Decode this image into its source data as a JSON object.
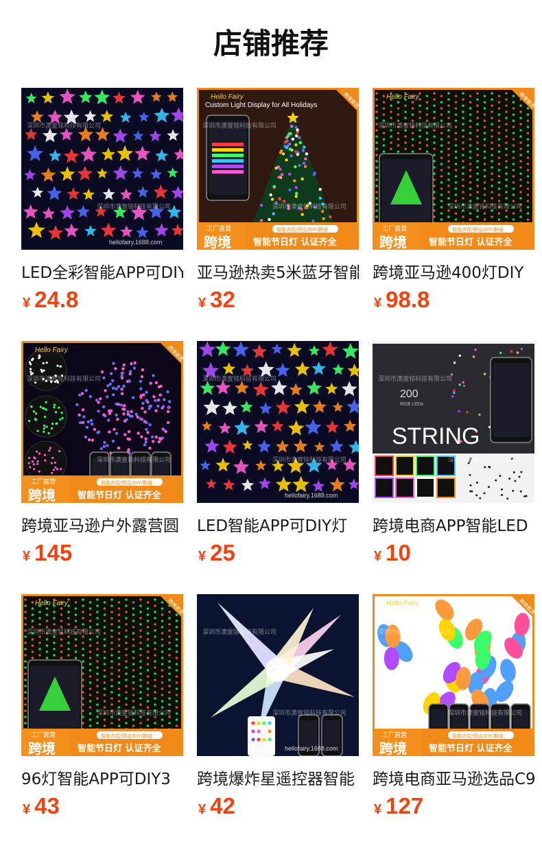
{
  "page": {
    "title": "店铺推荐"
  },
  "colors": {
    "price": "#f2420f",
    "banner_orange": "#f28a1a"
  },
  "products": [
    {
      "name": "LED全彩智能APP可DIY",
      "currency": "¥",
      "price": "24.8",
      "image_icon": "star-lights-icon",
      "brand_text": "",
      "watermark": "深圳市澳壹铭科技有限公司",
      "site": "hellofairy.1688.com",
      "banner": false,
      "caption": ""
    },
    {
      "name": "亚马逊热卖5米蓝牙智能",
      "currency": "¥",
      "price": "32",
      "image_icon": "christmas-tree-icon",
      "brand_text": "Hello Fairy",
      "watermark": "深圳市澳壹铭科技有限公司",
      "site": "",
      "banner": true,
      "caption": "Custom Light Display for All Holidays"
    },
    {
      "name": "跨境亚马逊400灯DIY",
      "currency": "¥",
      "price": "98.8",
      "image_icon": "curtain-lights-icon",
      "brand_text": "Hello Fairy",
      "watermark": "深圳市澳壹铭科技有限公司",
      "site": "",
      "banner": true,
      "caption": ""
    },
    {
      "name": "跨境亚马逊户外露营圆",
      "currency": "¥",
      "price": "145",
      "image_icon": "sphere-lights-icon",
      "brand_text": "Hello Fairy",
      "watermark": "深圳市澳壹铭科技有限公司",
      "site": "",
      "banner": true,
      "caption": ""
    },
    {
      "name": "LED智能APP可DIY灯",
      "currency": "¥",
      "price": "25",
      "image_icon": "star-lights-icon",
      "brand_text": "",
      "watermark": "深圳市澳壹铭科技有限公司",
      "site": "hellofairy.1688.com",
      "banner": false,
      "caption": ""
    },
    {
      "name": "跨境电商APP智能LED",
      "currency": "¥",
      "price": "10",
      "image_icon": "string-lights-box-icon",
      "brand_text": "",
      "watermark": "深圳市澳壹铭科技有限公司",
      "site": "",
      "banner": false,
      "caption": "",
      "box_count": "200",
      "box_sub": "RGB LEDs",
      "box_word": "STRING"
    },
    {
      "name": "96灯智能APP可DIY3",
      "currency": "¥",
      "price": "43",
      "image_icon": "curtain-lights-icon",
      "brand_text": "Hello Fairy",
      "watermark": "深圳市澳壹铭科技有限公司",
      "site": "",
      "banner": true,
      "caption": ""
    },
    {
      "name": "跨境爆炸星遥控器智能",
      "currency": "¥",
      "price": "42",
      "image_icon": "exploding-star-icon",
      "brand_text": "",
      "watermark": "深圳市澳壹铭科技有限公司",
      "site": "hellofairy.1688.com",
      "banner": false,
      "caption": ""
    },
    {
      "name": "跨境电商亚马逊选品C9",
      "currency": "¥",
      "price": "127",
      "image_icon": "c9-bulbs-icon",
      "brand_text": "Hello Fairy",
      "watermark": "深圳市澳壹铭科技有限公司",
      "site": "",
      "banner": true,
      "caption": ""
    }
  ],
  "banner": {
    "factory": "工厂直营",
    "crossborder": "跨境",
    "tagline": "智能节日灯 认证齐全",
    "features": "智能点控/预设/DIY/群组",
    "corner": "跨境首选"
  }
}
